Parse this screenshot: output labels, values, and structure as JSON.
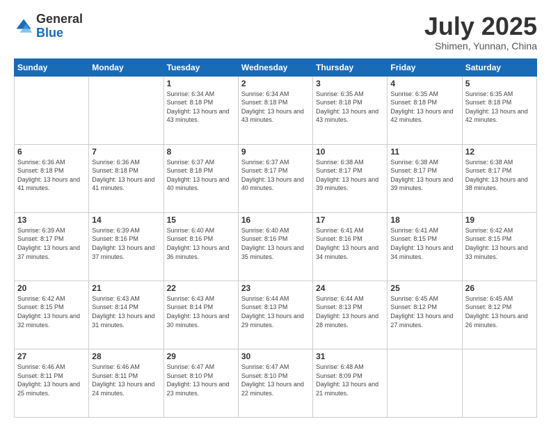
{
  "logo": {
    "general": "General",
    "blue": "Blue"
  },
  "header": {
    "month": "July 2025",
    "location": "Shimen, Yunnan, China"
  },
  "days_of_week": [
    "Sunday",
    "Monday",
    "Tuesday",
    "Wednesday",
    "Thursday",
    "Friday",
    "Saturday"
  ],
  "weeks": [
    [
      {
        "day": "",
        "info": ""
      },
      {
        "day": "",
        "info": ""
      },
      {
        "day": "1",
        "info": "Sunrise: 6:34 AM\nSunset: 8:18 PM\nDaylight: 13 hours and 43 minutes."
      },
      {
        "day": "2",
        "info": "Sunrise: 6:34 AM\nSunset: 8:18 PM\nDaylight: 13 hours and 43 minutes."
      },
      {
        "day": "3",
        "info": "Sunrise: 6:35 AM\nSunset: 8:18 PM\nDaylight: 13 hours and 43 minutes."
      },
      {
        "day": "4",
        "info": "Sunrise: 6:35 AM\nSunset: 8:18 PM\nDaylight: 13 hours and 42 minutes."
      },
      {
        "day": "5",
        "info": "Sunrise: 6:35 AM\nSunset: 8:18 PM\nDaylight: 13 hours and 42 minutes."
      }
    ],
    [
      {
        "day": "6",
        "info": "Sunrise: 6:36 AM\nSunset: 8:18 PM\nDaylight: 13 hours and 41 minutes."
      },
      {
        "day": "7",
        "info": "Sunrise: 6:36 AM\nSunset: 8:18 PM\nDaylight: 13 hours and 41 minutes."
      },
      {
        "day": "8",
        "info": "Sunrise: 6:37 AM\nSunset: 8:18 PM\nDaylight: 13 hours and 40 minutes."
      },
      {
        "day": "9",
        "info": "Sunrise: 6:37 AM\nSunset: 8:17 PM\nDaylight: 13 hours and 40 minutes."
      },
      {
        "day": "10",
        "info": "Sunrise: 6:38 AM\nSunset: 8:17 PM\nDaylight: 13 hours and 39 minutes."
      },
      {
        "day": "11",
        "info": "Sunrise: 6:38 AM\nSunset: 8:17 PM\nDaylight: 13 hours and 39 minutes."
      },
      {
        "day": "12",
        "info": "Sunrise: 6:38 AM\nSunset: 8:17 PM\nDaylight: 13 hours and 38 minutes."
      }
    ],
    [
      {
        "day": "13",
        "info": "Sunrise: 6:39 AM\nSunset: 8:17 PM\nDaylight: 13 hours and 37 minutes."
      },
      {
        "day": "14",
        "info": "Sunrise: 6:39 AM\nSunset: 8:16 PM\nDaylight: 13 hours and 37 minutes."
      },
      {
        "day": "15",
        "info": "Sunrise: 6:40 AM\nSunset: 8:16 PM\nDaylight: 13 hours and 36 minutes."
      },
      {
        "day": "16",
        "info": "Sunrise: 6:40 AM\nSunset: 8:16 PM\nDaylight: 13 hours and 35 minutes."
      },
      {
        "day": "17",
        "info": "Sunrise: 6:41 AM\nSunset: 8:16 PM\nDaylight: 13 hours and 34 minutes."
      },
      {
        "day": "18",
        "info": "Sunrise: 6:41 AM\nSunset: 8:15 PM\nDaylight: 13 hours and 34 minutes."
      },
      {
        "day": "19",
        "info": "Sunrise: 6:42 AM\nSunset: 8:15 PM\nDaylight: 13 hours and 33 minutes."
      }
    ],
    [
      {
        "day": "20",
        "info": "Sunrise: 6:42 AM\nSunset: 8:15 PM\nDaylight: 13 hours and 32 minutes."
      },
      {
        "day": "21",
        "info": "Sunrise: 6:43 AM\nSunset: 8:14 PM\nDaylight: 13 hours and 31 minutes."
      },
      {
        "day": "22",
        "info": "Sunrise: 6:43 AM\nSunset: 8:14 PM\nDaylight: 13 hours and 30 minutes."
      },
      {
        "day": "23",
        "info": "Sunrise: 6:44 AM\nSunset: 8:13 PM\nDaylight: 13 hours and 29 minutes."
      },
      {
        "day": "24",
        "info": "Sunrise: 6:44 AM\nSunset: 8:13 PM\nDaylight: 13 hours and 28 minutes."
      },
      {
        "day": "25",
        "info": "Sunrise: 6:45 AM\nSunset: 8:12 PM\nDaylight: 13 hours and 27 minutes."
      },
      {
        "day": "26",
        "info": "Sunrise: 6:45 AM\nSunset: 8:12 PM\nDaylight: 13 hours and 26 minutes."
      }
    ],
    [
      {
        "day": "27",
        "info": "Sunrise: 6:46 AM\nSunset: 8:11 PM\nDaylight: 13 hours and 25 minutes."
      },
      {
        "day": "28",
        "info": "Sunrise: 6:46 AM\nSunset: 8:11 PM\nDaylight: 13 hours and 24 minutes."
      },
      {
        "day": "29",
        "info": "Sunrise: 6:47 AM\nSunset: 8:10 PM\nDaylight: 13 hours and 23 minutes."
      },
      {
        "day": "30",
        "info": "Sunrise: 6:47 AM\nSunset: 8:10 PM\nDaylight: 13 hours and 22 minutes."
      },
      {
        "day": "31",
        "info": "Sunrise: 6:48 AM\nSunset: 8:09 PM\nDaylight: 13 hours and 21 minutes."
      },
      {
        "day": "",
        "info": ""
      },
      {
        "day": "",
        "info": ""
      }
    ]
  ]
}
